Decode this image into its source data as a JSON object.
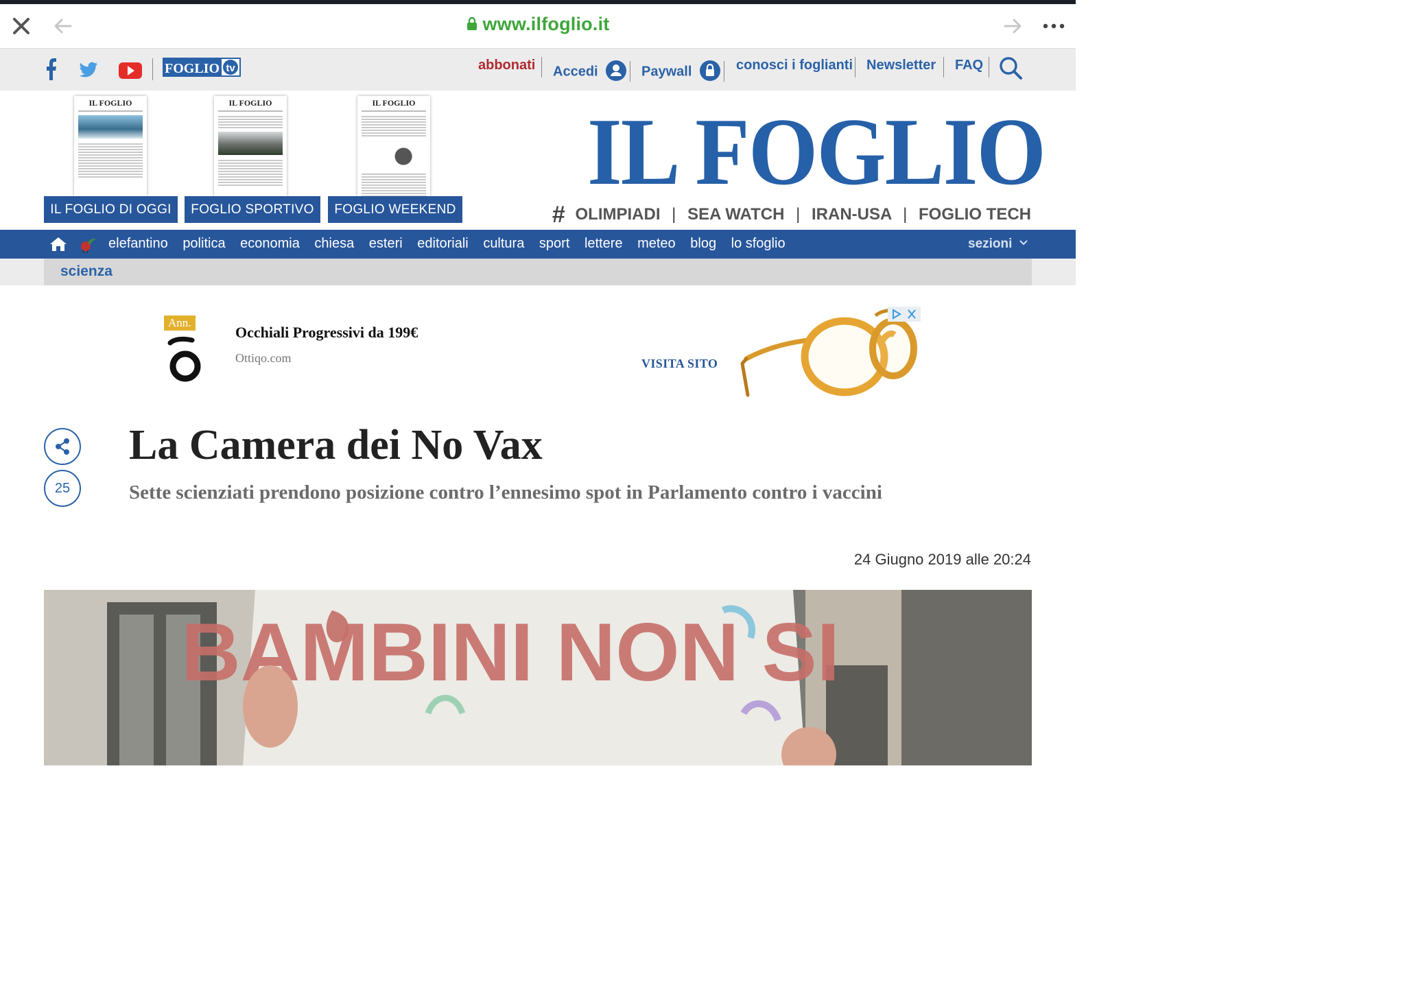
{
  "browser": {
    "url": "www.ilfoglio.it"
  },
  "social": {
    "icons": [
      "facebook-icon",
      "twitter-icon",
      "youtube-icon"
    ],
    "foglio_tv": "FOGLIO tv"
  },
  "utility": {
    "abbonati": "abbonati",
    "accedi": "Accedi",
    "paywall": "Paywall",
    "conosci": "conosci i foglianti",
    "newsletter": "Newsletter",
    "faq": "FAQ"
  },
  "editions": {
    "covers": [
      {
        "masthead": "IL FOGLIO"
      },
      {
        "masthead": "IL FOGLIO"
      },
      {
        "masthead": "IL FOGLIO"
      }
    ],
    "buttons": [
      "IL FOGLIO DI OGGI",
      "FOGLIO SPORTIVO",
      "FOGLIO WEEKEND"
    ]
  },
  "masthead": {
    "logo": "IL FOGLIO",
    "hash": "#",
    "tags": [
      "OLIMPIADI",
      "SEA WATCH",
      "IRAN-USA",
      "FOGLIO TECH"
    ],
    "tag_sep": "|"
  },
  "nav": {
    "items": [
      "elefantino",
      "politica",
      "economia",
      "chiesa",
      "esteri",
      "editoriali",
      "cultura",
      "sport",
      "lettere",
      "meteo",
      "blog",
      "lo sfoglio"
    ],
    "sections_label": "sezioni"
  },
  "section": {
    "label": "scienza"
  },
  "ad": {
    "badge": "Ann.",
    "title": "Occhiali Progressivi da 199€",
    "domain": "Ottiqo.com",
    "cta": "VISITA SITO"
  },
  "article": {
    "comment_count": "25",
    "headline": "La Camera dei No Vax",
    "subhead": "Sette scienziati prendono posizione contro l’ennesimo spot in Parlamento contro i vaccini",
    "date": "24 Giugno 2019 alle 20:24",
    "hero_sign_text": "BAMBINI NON SI"
  },
  "colors": {
    "brand_blue": "#27569b",
    "logo_blue": "#2660a8",
    "url_green": "#3ea63a",
    "abbonati_red": "#b02a2f"
  }
}
